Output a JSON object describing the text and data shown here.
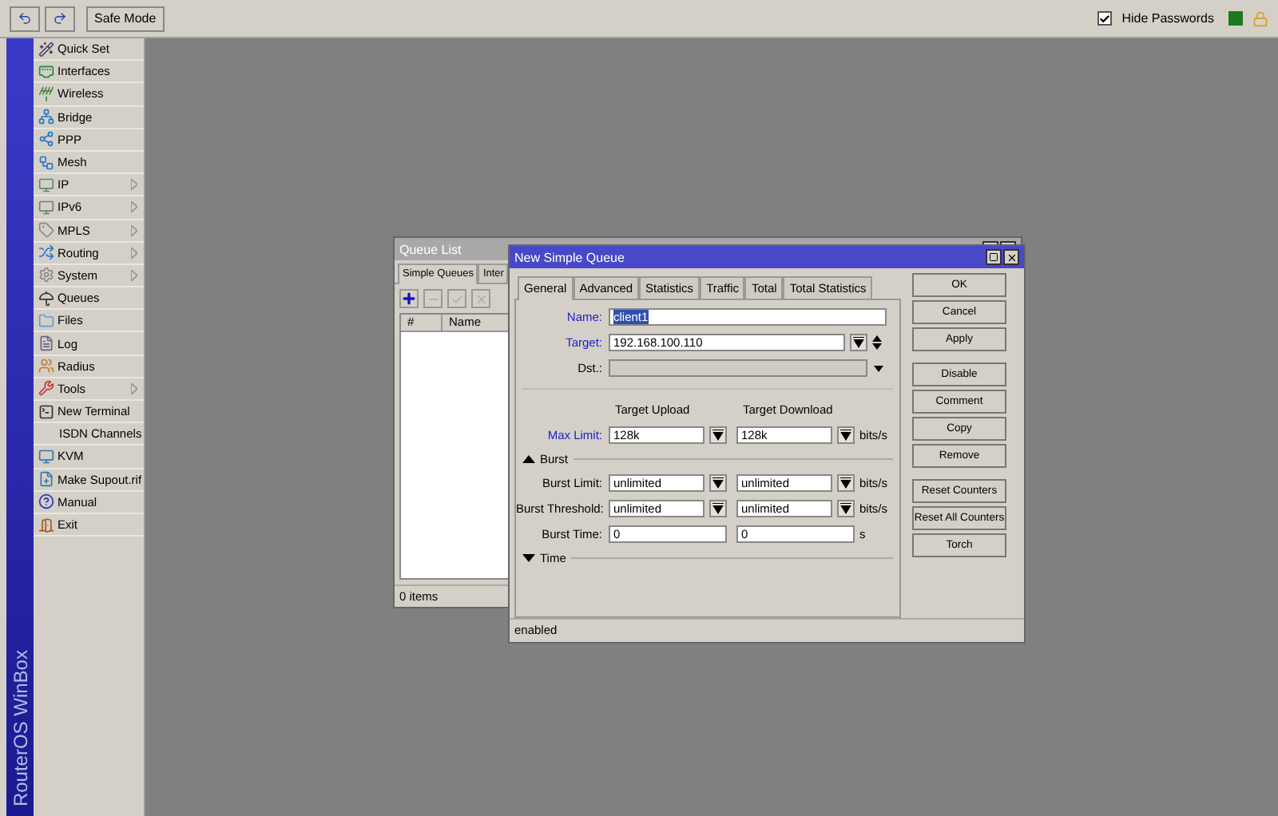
{
  "toolbar": {
    "safe_mode": "Safe Mode",
    "hide_passwords": {
      "label": "Hide Passwords",
      "checked": true
    }
  },
  "sidebar": {
    "brand": "RouterOS WinBox",
    "items": [
      {
        "label": "Quick Set",
        "submenu": false
      },
      {
        "label": "Interfaces",
        "submenu": false
      },
      {
        "label": "Wireless",
        "submenu": false
      },
      {
        "label": "Bridge",
        "submenu": false
      },
      {
        "label": "PPP",
        "submenu": false
      },
      {
        "label": "Mesh",
        "submenu": false
      },
      {
        "label": "IP",
        "submenu": true
      },
      {
        "label": "IPv6",
        "submenu": true
      },
      {
        "label": "MPLS",
        "submenu": true
      },
      {
        "label": "Routing",
        "submenu": true
      },
      {
        "label": "System",
        "submenu": true
      },
      {
        "label": "Queues",
        "submenu": false
      },
      {
        "label": "Files",
        "submenu": false
      },
      {
        "label": "Log",
        "submenu": false
      },
      {
        "label": "Radius",
        "submenu": false
      },
      {
        "label": "Tools",
        "submenu": true
      },
      {
        "label": "New Terminal",
        "submenu": false
      },
      {
        "label": "ISDN Channels",
        "submenu": false
      },
      {
        "label": "KVM",
        "submenu": false
      },
      {
        "label": "Make Supout.rif",
        "submenu": false
      },
      {
        "label": "Manual",
        "submenu": false
      },
      {
        "label": "Exit",
        "submenu": false
      }
    ]
  },
  "queue_list": {
    "title": "Queue List",
    "tabs": [
      {
        "label": "Simple Queues",
        "selected": true
      },
      {
        "label": "Inter",
        "selected": false
      }
    ],
    "columns": [
      "#",
      "Name"
    ],
    "status": "0 items"
  },
  "dialog": {
    "title": "New Simple Queue",
    "tabs": [
      {
        "label": "General",
        "selected": true
      },
      {
        "label": "Advanced",
        "selected": false
      },
      {
        "label": "Statistics",
        "selected": false
      },
      {
        "label": "Traffic",
        "selected": false
      },
      {
        "label": "Total",
        "selected": false
      },
      {
        "label": "Total Statistics",
        "selected": false
      }
    ],
    "name": {
      "label": "Name:",
      "value": "client1",
      "required": true
    },
    "target": {
      "label": "Target:",
      "value": "192.168.100.110",
      "required": true
    },
    "dst": {
      "label": "Dst.:",
      "disabled": true
    },
    "column_headers": [
      "Target Upload",
      "Target Download"
    ],
    "max_limit": {
      "label": "Max Limit:",
      "required": true,
      "upload": "128k",
      "download": "128k",
      "unit": "bits/s"
    },
    "burst": {
      "label": "Burst",
      "expanded": true,
      "rows": [
        {
          "label": "Burst Limit:",
          "kind": "dropdown",
          "upload": "unlimited",
          "download": "unlimited",
          "unit": "bits/s"
        },
        {
          "label": "Burst Threshold:",
          "kind": "dropdown",
          "upload": "unlimited",
          "download": "unlimited",
          "unit": "bits/s"
        },
        {
          "label": "Burst Time:",
          "kind": "text",
          "upload": "0",
          "download": "0",
          "unit": "s"
        }
      ]
    },
    "time": {
      "label": "Time",
      "expanded": false
    },
    "button_groups": [
      [
        "OK",
        "Cancel",
        "Apply"
      ],
      [
        "Disable",
        "Comment",
        "Copy",
        "Remove"
      ],
      [
        "Reset Counters",
        "Reset All Counters",
        "Torch"
      ]
    ],
    "status": "enabled"
  }
}
